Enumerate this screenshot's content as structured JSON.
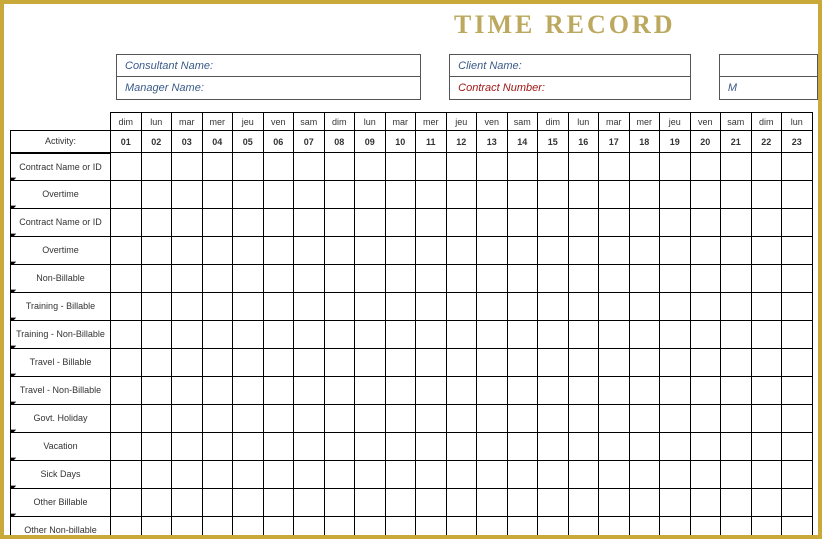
{
  "title": "TIME  RECORD",
  "info": {
    "consultant": "Consultant Name:",
    "manager": "Manager Name:",
    "client": "Client Name:",
    "contract": "Contract Number:",
    "far": "M"
  },
  "headers": {
    "activity": "Activity:"
  },
  "days": {
    "names": [
      "dim",
      "lun",
      "mar",
      "mer",
      "jeu",
      "ven",
      "sam",
      "dim",
      "lun",
      "mar",
      "mer",
      "jeu",
      "ven",
      "sam",
      "dim",
      "lun",
      "mar",
      "mer",
      "jeu",
      "ven",
      "sam",
      "dim",
      "lun"
    ],
    "nums": [
      "01",
      "02",
      "03",
      "04",
      "05",
      "06",
      "07",
      "08",
      "09",
      "10",
      "11",
      "12",
      "13",
      "14",
      "15",
      "16",
      "17",
      "18",
      "19",
      "20",
      "21",
      "22",
      "23"
    ]
  },
  "rows": [
    "Contract Name or ID",
    "Overtime",
    "Contract Name or ID",
    "Overtime",
    "Non-Billable",
    "Training - Billable",
    "Training - Non-Billable",
    "Travel - Billable",
    "Travel - Non-Billable",
    "Govt. Holiday",
    "Vacation",
    "Sick Days",
    "Other Billable",
    "Other Non-billable"
  ]
}
